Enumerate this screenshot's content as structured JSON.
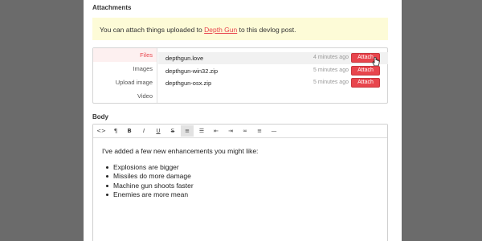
{
  "attachments": {
    "title": "Attachments",
    "notice": {
      "before": "You can attach things uploaded to ",
      "link": "Depth Gun",
      "after": " to this devlog post."
    },
    "tabs": [
      "Files",
      "Images",
      "Upload image",
      "Video"
    ],
    "active_tab": "Files",
    "files": [
      {
        "name": "depthgun.love",
        "time": "4 minutes ago",
        "button": "Attach"
      },
      {
        "name": "depthgun-win32.zip",
        "time": "5 minutes ago",
        "button": "Attach"
      },
      {
        "name": "depthgun-osx.zip",
        "time": "5 minutes ago",
        "button": "Attach"
      }
    ]
  },
  "body": {
    "label": "Body",
    "toolbar": [
      {
        "icon": "code-icon",
        "glyph": "<>"
      },
      {
        "icon": "paragraph-icon",
        "glyph": "¶"
      },
      {
        "icon": "bold-icon",
        "glyph": "B"
      },
      {
        "icon": "italic-icon",
        "glyph": "I"
      },
      {
        "icon": "underline-icon",
        "glyph": "U"
      },
      {
        "icon": "strikethrough-icon",
        "glyph": "S"
      },
      {
        "icon": "bullet-list-icon",
        "glyph": "≡"
      },
      {
        "icon": "numbered-list-icon",
        "glyph": "☰"
      },
      {
        "icon": "outdent-icon",
        "glyph": "⇤"
      },
      {
        "icon": "indent-icon",
        "glyph": "⇥"
      },
      {
        "icon": "link-icon",
        "glyph": "∞"
      },
      {
        "icon": "align-left-icon",
        "glyph": "≡"
      },
      {
        "icon": "horizontal-rule-icon",
        "glyph": "—"
      }
    ],
    "intro": "I've added a few new enhancements you might like:",
    "items": [
      "Explosions are bigger",
      "Missiles do more damage",
      "Machine gun shoots faster",
      "Enemies are more mean"
    ]
  },
  "colors": {
    "accent": "#e8454d",
    "notice_bg": "#fdfbd7",
    "overlay": "#6b6b6b"
  }
}
